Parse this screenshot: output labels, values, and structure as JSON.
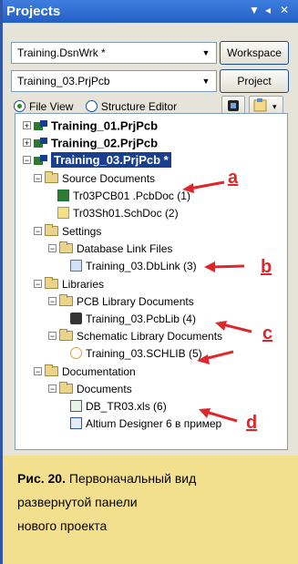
{
  "window": {
    "title": "Projects"
  },
  "workspace_combo": {
    "value": "Training.DsnWrk *"
  },
  "project_combo": {
    "value": "Training_03.PrjPcb"
  },
  "buttons": {
    "workspace": "Workspace",
    "project": "Project"
  },
  "view_options": {
    "file_view": "File View",
    "structure_editor": "Structure Editor",
    "selected": "file_view"
  },
  "tree": {
    "projects": [
      {
        "label": "Training_01.PrjPcb",
        "expander": "+"
      },
      {
        "label": "Training_02.PrjPcb",
        "expander": "+"
      },
      {
        "label": "Training_03.PrjPcb *",
        "expander": "−",
        "selected": true
      }
    ],
    "folders": [
      {
        "label": "Source Documents",
        "expander": "−",
        "children": [
          "Tr03PCB01 .PcbDoc (1)",
          "Tr03Sh01.SchDoc (2)"
        ]
      },
      {
        "label": "Settings",
        "expander": "−"
      },
      {
        "label": "Database Link Files",
        "expander": "−",
        "children": [
          "Training_03.DbLink (3)"
        ]
      },
      {
        "label": "Libraries",
        "expander": "−"
      },
      {
        "label": "PCB Library Documents",
        "expander": "−",
        "children": [
          "Training_03.PcbLib (4)"
        ]
      },
      {
        "label": "Schematic Library Documents",
        "expander": "−",
        "children": [
          "Training_03.SCHLIB (5)"
        ]
      },
      {
        "label": "Documentation",
        "expander": "−"
      },
      {
        "label": "Documents",
        "expander": "−",
        "children": [
          "DB_TR03.xls (6)",
          "Altium Designer 6 в пример"
        ]
      }
    ]
  },
  "annotations": {
    "a": "a",
    "b": "b",
    "c": "c",
    "d": "d"
  },
  "caption": {
    "figure": "Рис. 20.",
    "line1": "Первоначальный вид",
    "line2": "развернутой панели",
    "line3": "нового проекта"
  },
  "colors": {
    "titlebar": "#245ec6",
    "selection": "#1b3f8f",
    "annotation": "#e0262a",
    "caption_bg": "#f3e08e"
  }
}
